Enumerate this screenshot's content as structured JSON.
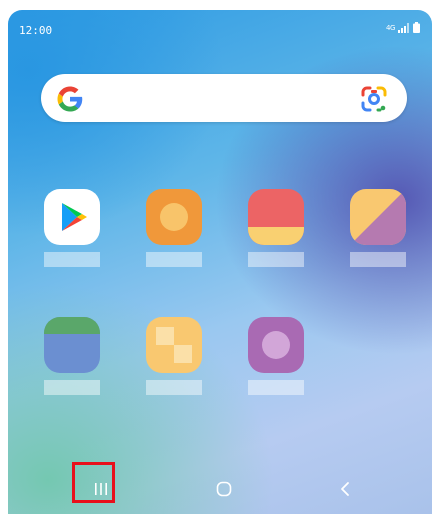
{
  "status_bar": {
    "time": "12:00",
    "network_label": "4G",
    "icons": [
      "network-type-icon",
      "signal-icon",
      "battery-icon"
    ]
  },
  "search": {
    "placeholder": "",
    "left_icon": "google-logo-icon",
    "right_icon": "google-lens-icon"
  },
  "home_apps": [
    {
      "id": "play-store",
      "icon": "play-store-icon",
      "label": ""
    },
    {
      "id": "app-orange-circle",
      "icon": "orange-circle-icon",
      "label": ""
    },
    {
      "id": "app-red-yellow",
      "icon": "red-yellow-icon",
      "label": ""
    },
    {
      "id": "app-yellow-purple",
      "icon": "yellow-purple-diagonal-icon",
      "label": ""
    },
    {
      "id": "app-green-blue",
      "icon": "green-blue-icon",
      "label": ""
    },
    {
      "id": "app-yellow-squares",
      "icon": "yellow-squares-icon",
      "label": ""
    },
    {
      "id": "app-purple-circle",
      "icon": "purple-circle-icon",
      "label": ""
    }
  ],
  "navigation": {
    "recents_icon": "recents-icon",
    "home_icon": "home-icon",
    "back_icon": "back-icon",
    "highlighted": "recents-button"
  },
  "colors": {
    "highlight": "#e8101c",
    "orange": "#f0983a",
    "red": "#ec6465",
    "yellow": "#f9d071",
    "purple": "#a96ab3",
    "blue": "#6b8fd1",
    "green": "#5aa76a"
  }
}
